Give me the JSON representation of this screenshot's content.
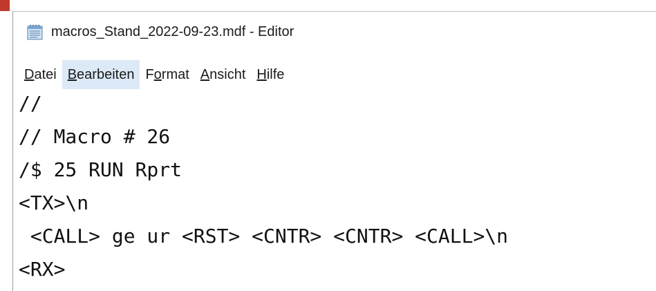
{
  "window": {
    "title": "macros_Stand_2022-09-23.mdf - Editor",
    "icon": "notepad-icon"
  },
  "menu": {
    "items": [
      {
        "pre": "",
        "key": "D",
        "post": "atei",
        "active": false
      },
      {
        "pre": "",
        "key": "B",
        "post": "earbeiten",
        "active": true
      },
      {
        "pre": "F",
        "key": "o",
        "post": "rmat",
        "active": false
      },
      {
        "pre": "",
        "key": "A",
        "post": "nsicht",
        "active": false
      },
      {
        "pre": "",
        "key": "H",
        "post": "ilfe",
        "active": false
      }
    ]
  },
  "editor": {
    "lines": [
      "//",
      "// Macro # 26",
      "/$ 25 RUN Rprt",
      "<TX>\\n",
      " <CALL> ge ur <RST> <CNTR> <CNTR> <CALL>\\n",
      "<RX>"
    ]
  },
  "colors": {
    "menu_active_bg": "#dce9f6",
    "text": "#111111",
    "background": "#ffffff"
  }
}
